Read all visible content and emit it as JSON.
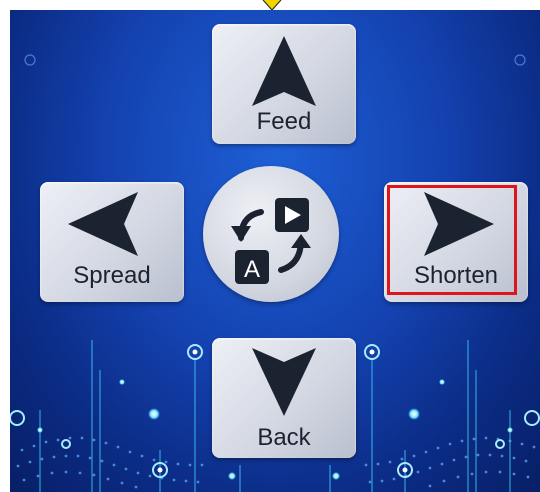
{
  "controls": {
    "up_label": "Feed",
    "down_label": "Back",
    "left_label": "Spread",
    "right_label": "Shorten",
    "center_button": {
      "icon": "translate-swap-icon",
      "letter": "A"
    },
    "highlighted": "right"
  },
  "colors": {
    "background_top": "#1e5fd6",
    "background_bottom": "#081f66",
    "button_face": "#d4d8e3",
    "arrow": "#1c2330",
    "highlight": "#e0151c",
    "glow": "#3fd1ff",
    "marker": "#f2d300"
  }
}
